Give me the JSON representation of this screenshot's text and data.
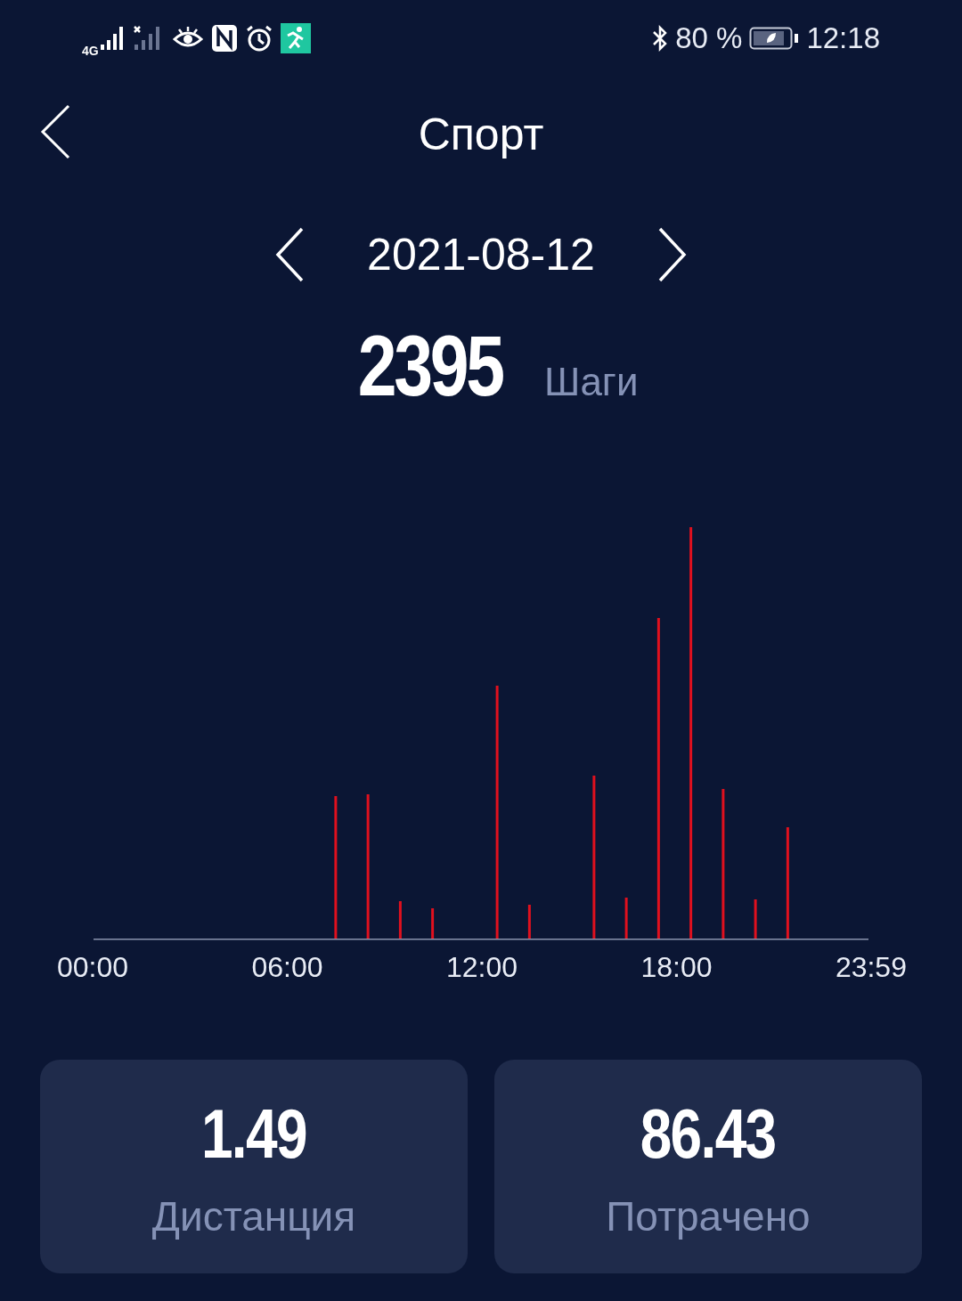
{
  "status_bar": {
    "network": "4G",
    "battery": "80 %",
    "time": "12:18"
  },
  "header": {
    "title": "Спорт"
  },
  "date_nav": {
    "date": "2021-08-12"
  },
  "summary": {
    "steps": "2395",
    "unit": "Шаги"
  },
  "chart": {
    "x_labels": [
      "00:00",
      "06:00",
      "12:00",
      "18:00",
      "23:59"
    ]
  },
  "stats": [
    {
      "value": "1.49",
      "label": "Дистанция"
    },
    {
      "value": "86.43",
      "label": "Потрачено"
    }
  ]
}
